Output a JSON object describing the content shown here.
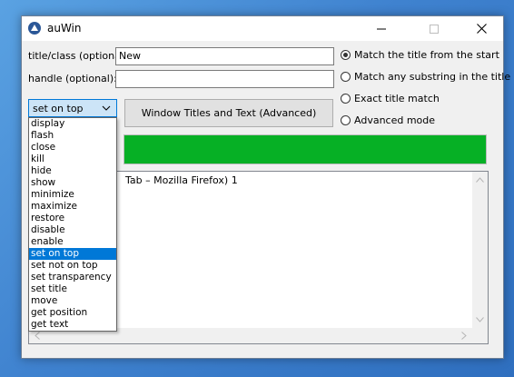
{
  "window": {
    "title": "auWin"
  },
  "form": {
    "title_label": "title/class (optional):",
    "title_value": "New",
    "handle_label": "handle (optional):",
    "handle_value": ""
  },
  "radios": [
    {
      "label": "Match the title from the start",
      "checked": true
    },
    {
      "label": "Match any substring in the title",
      "checked": false
    },
    {
      "label": "Exact title match",
      "checked": false
    },
    {
      "label": "Advanced mode",
      "checked": false
    }
  ],
  "action_combo": {
    "selected": "set on top",
    "options": [
      "display",
      "flash",
      "close",
      "kill",
      "hide",
      "show",
      "minimize",
      "maximize",
      "restore",
      "disable",
      "enable",
      "set on top",
      "set not on top",
      "set transparency",
      "set title",
      "move",
      "get position",
      "get text"
    ]
  },
  "advanced_button": {
    "label": "Window Titles and Text (Advanced)"
  },
  "progress": {
    "value": 1.0,
    "color": "#06b025"
  },
  "output": {
    "visible_text": "Tab – Mozilla Firefox) 1"
  },
  "icons": [
    "app-icon",
    "minimize-icon",
    "maximize-icon",
    "close-icon",
    "chevron-down-icon",
    "scroll-up-icon",
    "scroll-down-icon",
    "scroll-left-icon",
    "scroll-right-icon"
  ]
}
